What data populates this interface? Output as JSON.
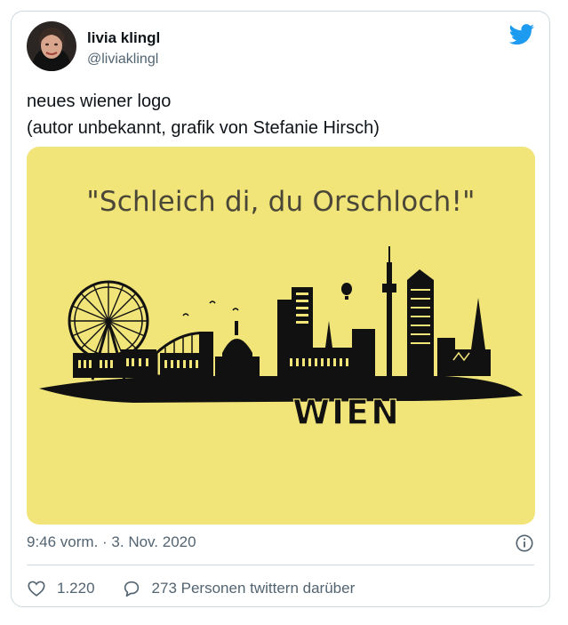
{
  "tweet": {
    "author_name": "livia klingl",
    "author_handle": "@liviaklingl",
    "text_line1": "neues wiener logo",
    "text_line2": "(autor unbekannt, grafik von Stefanie Hirsch)",
    "image": {
      "quote": "\"Schleich di, du Orschloch!\"",
      "city_label": "WIEN"
    },
    "timestamp": "9:46 vorm. · 3. Nov. 2020",
    "likes": "1.220",
    "retweet_text": "273 Personen twittern darüber"
  },
  "icons": {
    "brand": "twitter-bird-icon",
    "info": "info-icon",
    "like": "heart-icon",
    "reply": "speech-bubble-icon"
  },
  "colors": {
    "twitter_blue": "#1d9bf0",
    "image_background": "#f1e479",
    "skyline": "#111111",
    "secondary_text": "#536471"
  }
}
